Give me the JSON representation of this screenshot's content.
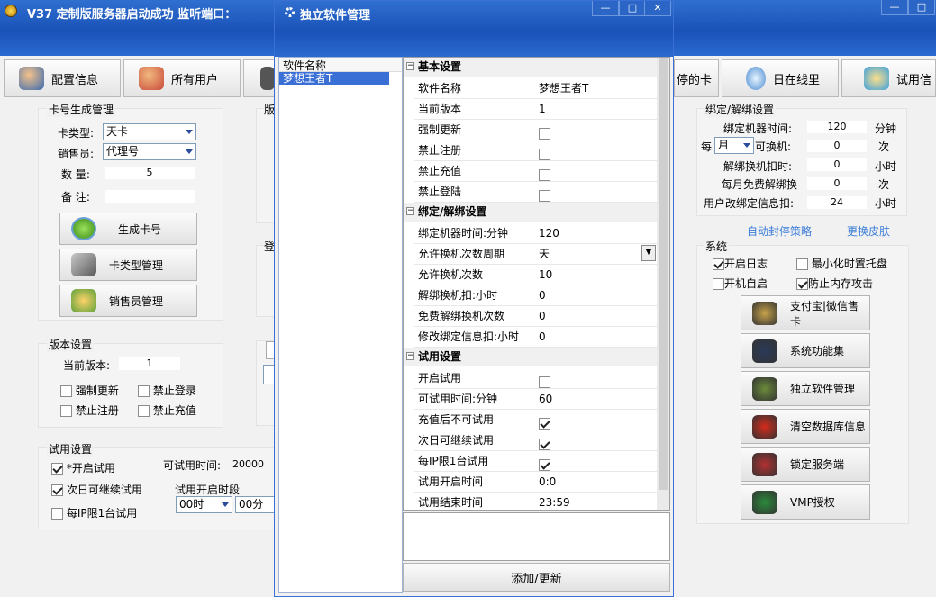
{
  "main": {
    "title": "V37 定制版服务器启动成功  监听端口：",
    "toolbar": [
      {
        "label": "配置信息",
        "icon": "user-key-icon"
      },
      {
        "label": "所有用户",
        "icon": "users-icon"
      },
      {
        "label": "停的卡",
        "icon": "card-icon"
      },
      {
        "label": "日在线里",
        "icon": "search-icon"
      },
      {
        "label": "试用信",
        "icon": "chat-icon"
      }
    ],
    "card_gen": {
      "title": "卡号生成管理",
      "card_type_label": "卡类型:",
      "card_type": "天卡",
      "seller_label": "销售员:",
      "seller": "代理号",
      "qty_label": "数 量:",
      "qty": "5",
      "note_label": "备 注:",
      "gen_btn": "生成卡号",
      "type_btn": "卡类型管理",
      "seller_btn": "销售员管理"
    },
    "frag_labels": [
      "版",
      "登"
    ],
    "version": {
      "title": "版本设置",
      "cur_label": "当前版本:",
      "cur": "1",
      "force": "强制更新",
      "nologin": "禁止登录",
      "noreg": "禁止注册",
      "nocharge": "禁止充值"
    },
    "trial": {
      "title": "试用设置",
      "enable": "*开启试用",
      "time_label": "可试用时间:",
      "time": "20000",
      "nextday": "次日可继续试用",
      "period_label": "试用开启时段",
      "hour": "00时",
      "minute": "00分",
      "perip": "每IP限1台试用"
    },
    "bind": {
      "title": "绑定/解绑设置",
      "bindtime_label": "绑定机器时间:",
      "bindtime": "120",
      "bindtime_unit": "分钟",
      "per": "每",
      "period": "月",
      "changes_label": "可换机:",
      "changes": "0",
      "changes_unit": "次",
      "unbind_label": "解绑换机扣时:",
      "unbind": "0",
      "unbind_unit": "小时",
      "free_label": "每月免费解绑换",
      "free": "0",
      "free_unit": "次",
      "modify_label": "用户改绑定信息扣:",
      "modify": "24",
      "modify_unit": "小时"
    },
    "links": {
      "auto": "自动封停策略",
      "skin": "更换皮肤"
    },
    "system": {
      "title": "系统",
      "log": "开启日志",
      "tray": "最小化时置托盘",
      "autostart": "开机自启",
      "antimem": "防止内存攻击"
    },
    "right_buttons": [
      {
        "label": "支付宝|微信售卡",
        "icon": "money-bag-icon",
        "color": "#c8a24a"
      },
      {
        "label": "系统功能集",
        "icon": "tools-icon",
        "color": "#2a3a5a"
      },
      {
        "label": "独立软件管理",
        "icon": "gears-icon",
        "color": "#6a8a3a"
      },
      {
        "label": "清空数据库信息",
        "icon": "clear-icon",
        "color": "#d62a1a"
      },
      {
        "label": "锁定服务端",
        "icon": "lock-icon",
        "color": "#b33030"
      },
      {
        "label": "VMP授权",
        "icon": "shield-icon",
        "color": "#2a8a3a"
      }
    ]
  },
  "dialog": {
    "title": "独立软件管理",
    "list_header": "软件名称",
    "list_item": "梦想王者T",
    "sections": [
      {
        "title": "基本设置",
        "rows": [
          {
            "n": "软件名称",
            "v": "梦想王者T"
          },
          {
            "n": "当前版本",
            "v": "1"
          },
          {
            "n": "强制更新",
            "cb": false
          },
          {
            "n": "禁止注册",
            "cb": false
          },
          {
            "n": "禁止充值",
            "cb": false
          },
          {
            "n": "禁止登陆",
            "cb": false
          }
        ]
      },
      {
        "title": "绑定/解绑设置",
        "rows": [
          {
            "n": "绑定机器时间:分钟",
            "v": "120"
          },
          {
            "n": "允许换机次数周期",
            "v": "天",
            "dd": true
          },
          {
            "n": "允许换机次数",
            "v": "10"
          },
          {
            "n": "解绑换机扣:小时",
            "v": "0"
          },
          {
            "n": "免费解绑换机次数",
            "v": "0"
          },
          {
            "n": "修改绑定信息扣:小时",
            "v": "0"
          }
        ]
      },
      {
        "title": "试用设置",
        "rows": [
          {
            "n": "开启试用",
            "cb": false
          },
          {
            "n": "可试用时间:分钟",
            "v": "60"
          },
          {
            "n": "充值后不可试用",
            "cb": true
          },
          {
            "n": "次日可继续试用",
            "cb": true
          },
          {
            "n": "每IP限1台试用",
            "cb": true
          },
          {
            "n": "试用开启时间",
            "v": "0:0"
          },
          {
            "n": "试用结束时间",
            "v": "23:59"
          }
        ]
      }
    ],
    "submit": "添加/更新"
  }
}
